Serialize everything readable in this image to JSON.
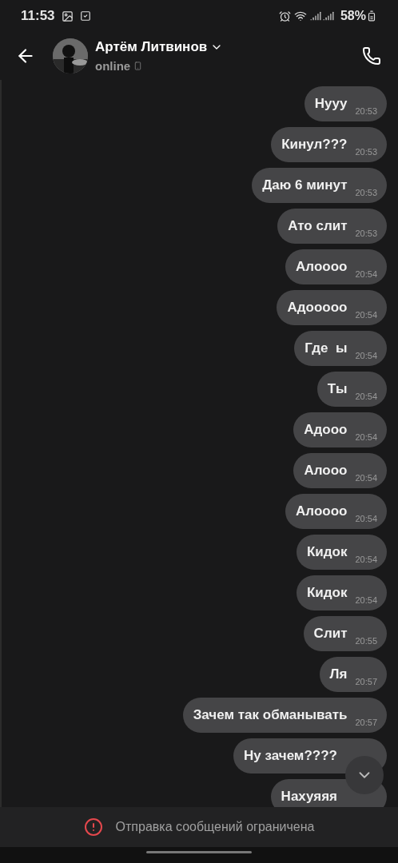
{
  "status_bar": {
    "time": "11:53",
    "battery": "58%"
  },
  "header": {
    "name": "Артём Литвинов",
    "status": "online"
  },
  "messages": [
    {
      "text": "Нууу",
      "time": "20:53"
    },
    {
      "text": "Кинул???",
      "time": "20:53"
    },
    {
      "text": "Даю 6 минут",
      "time": "20:53"
    },
    {
      "text": "Ато слит",
      "time": "20:53"
    },
    {
      "text": "Алоооо",
      "time": "20:54"
    },
    {
      "text": "Адооооо",
      "time": "20:54"
    },
    {
      "text": "Где  ы",
      "time": "20:54"
    },
    {
      "text": "Ты",
      "time": "20:54"
    },
    {
      "text": "Адооо",
      "time": "20:54"
    },
    {
      "text": "Алооо",
      "time": "20:54"
    },
    {
      "text": "Алоооо",
      "time": "20:54"
    },
    {
      "text": "Кидок",
      "time": "20:54"
    },
    {
      "text": "Кидок",
      "time": "20:54"
    },
    {
      "text": "Слит",
      "time": "20:55"
    },
    {
      "text": "Ля",
      "time": "20:57"
    },
    {
      "text": "Зачем так обманывать",
      "time": "20:57"
    },
    {
      "text": "Ну зачем????"
    },
    {
      "text": "Нахуяяя"
    }
  ],
  "footer": {
    "notice": "Отправка сообщений ограничена"
  }
}
